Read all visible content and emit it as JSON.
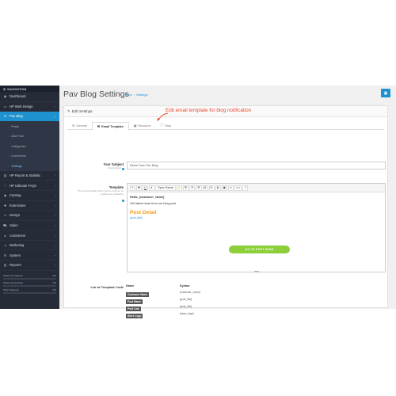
{
  "sidebar": {
    "header": "NAVIGATION",
    "items_top": [
      {
        "label": "Dashboard",
        "icon": "dashboard-icon",
        "glyph": "◉",
        "chev": ""
      },
      {
        "label": "HP Web Design",
        "icon": "desktop-icon",
        "glyph": "▭",
        "chev": "›"
      },
      {
        "label": "Pav Blog",
        "icon": "rss-icon",
        "glyph": "≋",
        "chev": "⌄"
      }
    ],
    "sub_items": [
      "Posts",
      "Add Post",
      "Categories",
      "Comments",
      "Settings"
    ],
    "items_bottom": [
      {
        "label": "HP Report & Statistic",
        "icon": "chart-icon",
        "glyph": "▥",
        "chev": "›"
      },
      {
        "label": "HP Ultimate FAQs",
        "icon": "question-icon",
        "glyph": "?",
        "chev": "›"
      },
      {
        "label": "Catalog",
        "icon": "tag-icon",
        "glyph": "◆",
        "chev": "›"
      },
      {
        "label": "Extensions",
        "icon": "puzzle-icon",
        "glyph": "✚",
        "chev": "›"
      },
      {
        "label": "Design",
        "icon": "monitor-icon",
        "glyph": "▭",
        "chev": "›"
      },
      {
        "label": "Sales",
        "icon": "cart-icon",
        "glyph": "⛟",
        "chev": "›"
      },
      {
        "label": "Customers",
        "icon": "user-icon",
        "glyph": "●",
        "chev": "›"
      },
      {
        "label": "Marketing",
        "icon": "share-icon",
        "glyph": "◂",
        "chev": "›"
      },
      {
        "label": "System",
        "icon": "gear-icon",
        "glyph": "⚙",
        "chev": "›"
      },
      {
        "label": "Reports",
        "icon": "bar-chart-icon",
        "glyph": "▤",
        "chev": "›"
      }
    ],
    "stats": [
      {
        "label": "Orders Completed",
        "value": "0%"
      },
      {
        "label": "Orders Processing",
        "value": "0%"
      },
      {
        "label": "Other Statuses",
        "value": "0%"
      }
    ]
  },
  "header": {
    "title": "Pav Blog Settings",
    "breadcrumb_home": "Home",
    "breadcrumb_sep": "›",
    "breadcrumb_current": "Settings",
    "save_icon": "save-icon"
  },
  "panel": {
    "title": "Edit Settings",
    "annotation": "Edit email template for blog notification",
    "tabs": [
      {
        "label": "General",
        "icon": "gear-icon",
        "glyph": "⚙"
      },
      {
        "label": "Email Template",
        "icon": "envelope-icon",
        "glyph": "✉"
      },
      {
        "label": "Resource",
        "icon": "image-icon",
        "glyph": "▣"
      },
      {
        "label": "Help",
        "icon": "info-icon",
        "glyph": "ⓘ"
      }
    ]
  },
  "form": {
    "subject_label": "Your Subject",
    "subject_help": "Email subject",
    "subject_value": "News From Our Blog",
    "template_label": "Template",
    "template_help": "This email template will be sent to customer on update post notification"
  },
  "editor": {
    "toolbar": [
      "✎",
      "B",
      "U",
      "✗",
      "Open Sans",
      "A",
      "☰",
      "☷",
      "☰",
      "⊞",
      "⊟",
      "⊠",
      "▣",
      "✕",
      "</>",
      "?"
    ],
    "greeting": "Hello, {customer_name}",
    "body": "Get latest news from our blog post.",
    "post_detail": "Post Detail",
    "post_title": "{post_title}",
    "button": "GO TO POST PAGE"
  },
  "codes": {
    "label": "List of Template Code",
    "header_name": "Name",
    "header_syntax": "Syntax",
    "rows": [
      {
        "name": "Customer Name",
        "syntax": "{customer_name}"
      },
      {
        "name": "Post Name",
        "syntax": "{post_title}"
      },
      {
        "name": "Post Link",
        "syntax": "{post_link}"
      },
      {
        "name": "Store Logo",
        "syntax": "{store_logo}"
      }
    ]
  }
}
